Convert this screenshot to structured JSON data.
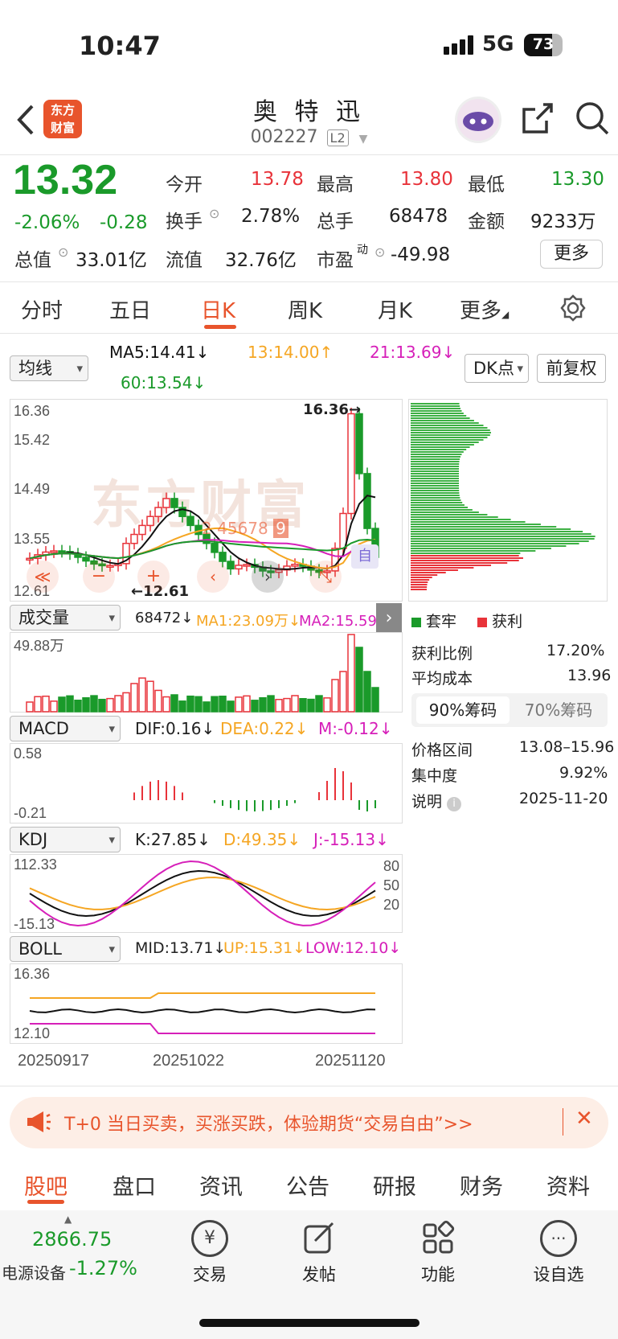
{
  "status": {
    "time": "10:47",
    "network": "5G",
    "battery": "73",
    "battery_level": 0.73
  },
  "header": {
    "back_icon": "chevron-left-icon",
    "logo_line1": "东方",
    "logo_line2": "财富",
    "name": "奥 特 迅",
    "code": "002227",
    "level": "L2"
  },
  "quote": {
    "price": "13.32",
    "pct": "-2.06%",
    "chg": "-0.28",
    "open_label": "今开",
    "open": "13.78",
    "high_label": "最高",
    "high": "13.80",
    "low_label": "最低",
    "low": "13.30",
    "turnover_label": "换手",
    "turnover": "2.78%",
    "volume_label": "总手",
    "volume": "68478",
    "amount_label": "金额",
    "amount": "9233万",
    "mktcap_label": "总值",
    "mktcap": "33.01亿",
    "float_label": "流值",
    "float": "32.76亿",
    "pe_label": "市盈",
    "pe_sup": "动",
    "pe": "-49.98",
    "more": "更多"
  },
  "tabs": [
    "分时",
    "五日",
    "日K",
    "周K",
    "月K",
    "更多"
  ],
  "active_tab": "日K",
  "kline": {
    "ma_select": "均线",
    "ma5": "MA5:14.41↓",
    "ma13": "13:14.00↑",
    "ma21": "21:13.69↓",
    "ma60": "60:13.54↓",
    "dk_button": "DK点",
    "adjust_button": "前复权",
    "y_labels": [
      "16.36",
      "15.42",
      "14.49",
      "13.55",
      "12.61"
    ],
    "high_marker": "16.36",
    "low_marker": "12.61",
    "self_tag": "自",
    "seq": [
      "2",
      "4",
      "5",
      "6",
      "7",
      "8",
      "9"
    ]
  },
  "volume": {
    "select": "成交量",
    "value": "68472↓",
    "ma1": "MA1:23.09万↓",
    "ma2": "MA2:15.59万↓",
    "y_top": "49.88万"
  },
  "macd": {
    "select": "MACD",
    "dif": "DIF:0.16↓",
    "dea": "DEA:0.22↓",
    "m": "M:-0.12↓",
    "y_top": "0.58",
    "y_bottom": "-0.21"
  },
  "kdj": {
    "select": "KDJ",
    "k": "K:27.85↓",
    "d": "D:49.35↓",
    "j": "J:-15.13↓",
    "y_top": "112.33",
    "y_bottom": "-15.13",
    "levels": [
      "80",
      "50",
      "20"
    ]
  },
  "boll": {
    "select": "BOLL",
    "mid": "MID:13.71↓",
    "up": "UP:15.31↓",
    "low": "LOW:12.10↓",
    "y_top": "16.36",
    "y_bottom": "12.10"
  },
  "dates": [
    "20250917",
    "20251022",
    "20251120"
  ],
  "chips": {
    "legend_hold": "套牢",
    "legend_profit": "获利",
    "profit_ratio_label": "获利比例",
    "profit_ratio": "17.20%",
    "avg_cost_label": "平均成本",
    "avg_cost": "13.96",
    "tab90": "90%筹码",
    "tab70": "70%筹码",
    "range_label": "价格区间",
    "range": "13.08–15.96",
    "conc_label": "集中度",
    "conc": "9.92%",
    "note_label": "说明",
    "note_date": "2025-11-20"
  },
  "banner": {
    "text": "T+0 当日买卖，买涨买跌，体验期货“交易自由”>>"
  },
  "bottom_tabs": [
    "股吧",
    "盘口",
    "资讯",
    "公告",
    "研报",
    "财务",
    "资料"
  ],
  "footer": {
    "index_value": "2866.75",
    "index_name": "电源设备",
    "index_pct": "-1.27%",
    "trade": "交易",
    "post": "发帖",
    "function": "功能",
    "watch": "设自选"
  },
  "colors": {
    "up": "#e8333a",
    "down": "#1a9a2a",
    "accent": "#e8542c",
    "ma5": "#111111",
    "ma13": "#f5a623",
    "ma21": "#d61fb9",
    "ma60": "#1a9a2a"
  }
}
